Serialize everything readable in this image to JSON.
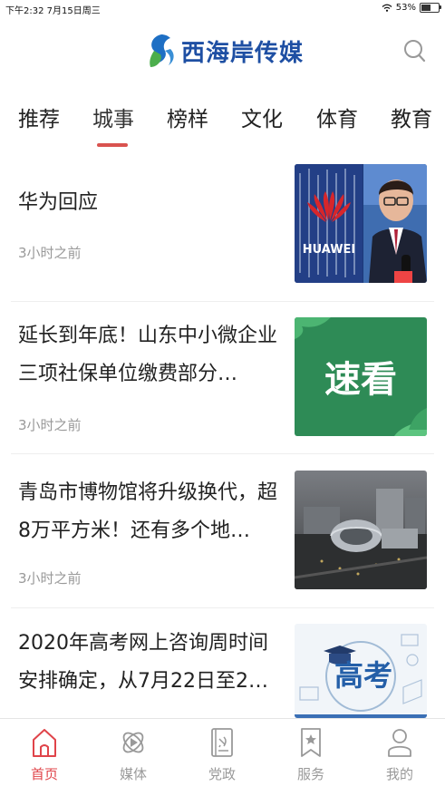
{
  "statusbar": {
    "time": "下午2:32  7月15日周三",
    "battery": "53%",
    "battery_level": 0.53
  },
  "header": {
    "logo_text": "西海岸传媒",
    "search_icon": "search-icon"
  },
  "tabs": [
    {
      "label": "推荐"
    },
    {
      "label": "城事",
      "active": true
    },
    {
      "label": "榜样"
    },
    {
      "label": "文化"
    },
    {
      "label": "体育"
    },
    {
      "label": "教育"
    }
  ],
  "news": [
    {
      "title": "华为回应",
      "time": "3小时之前",
      "thumb": "huawei",
      "thumb_text": "HUAWEI"
    },
    {
      "title": "延长到年底！山东中小微企业三项社保单位缴费部分…",
      "time": "3小时之前",
      "thumb": "sukan",
      "thumb_text": "速看"
    },
    {
      "title": "青岛市博物馆将升级换代，超8万平方米！还有多个地…",
      "time": "3小时之前",
      "thumb": "museum"
    },
    {
      "title": "2020年高考网上咨询周时间安排确定，从7月22日至2…",
      "time": "",
      "thumb": "gaokao",
      "thumb_text": "高考"
    }
  ],
  "bottom_nav": [
    {
      "label": "首页",
      "icon": "home-icon",
      "active": true
    },
    {
      "label": "媒体",
      "icon": "media-icon"
    },
    {
      "label": "党政",
      "icon": "party-book-icon"
    },
    {
      "label": "服务",
      "icon": "service-bookmark-icon"
    },
    {
      "label": "我的",
      "icon": "user-icon"
    }
  ],
  "colors": {
    "accent": "#e0444a",
    "brand": "#1e4fa3",
    "muted": "#999999"
  }
}
